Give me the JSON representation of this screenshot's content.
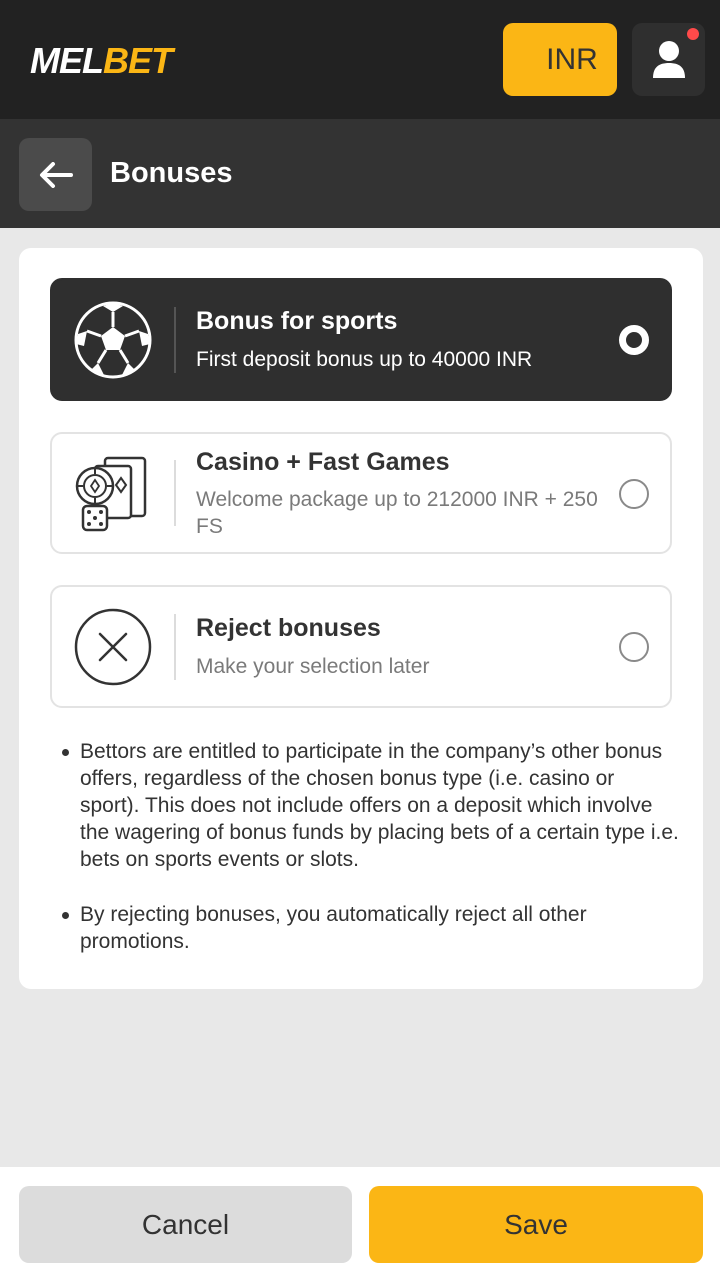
{
  "header": {
    "logo_part1": "MEL",
    "logo_part2": "BET",
    "currency_label": "INR",
    "accent_color": "#fbb615",
    "notification_color": "#ff4a4a",
    "profile_icon": "user-icon"
  },
  "subheader": {
    "back_icon": "arrow-left-icon",
    "title": "Bonuses"
  },
  "options": [
    {
      "icon": "soccer-ball-icon",
      "title": "Bonus for sports",
      "description": "First deposit bonus up to 40000 INR",
      "selected": true
    },
    {
      "icon": "casino-chips-cards-dice-icon",
      "title": "Casino + Fast Games",
      "description": "Welcome package up to 212000 INR + 250 FS",
      "selected": false
    },
    {
      "icon": "close-circle-icon",
      "title": "Reject bonuses",
      "description": "Make your selection later",
      "selected": false
    }
  ],
  "notes": [
    "Bettors are entitled to participate in the company’s other bonus offers, regardless of the chosen bonus type (i.e. casino or sport). This does not include offers on a deposit which involve the wagering of bonus funds by placing bets of a certain type i.e. bets on sports events or slots.",
    "By rejecting bonuses, you automatically reject all other promotions."
  ],
  "footer": {
    "cancel_label": "Cancel",
    "save_label": "Save"
  }
}
